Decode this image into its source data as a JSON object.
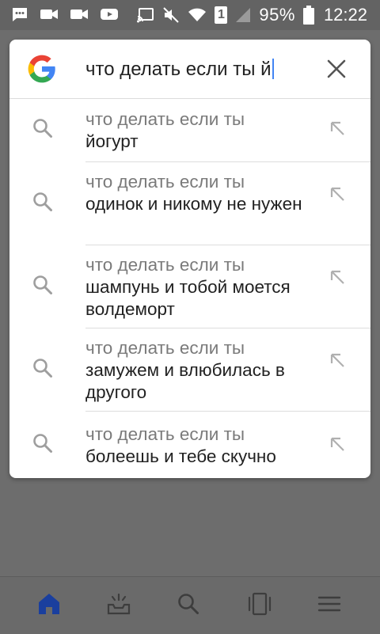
{
  "status_bar": {
    "battery_percent": "95%",
    "time": "12:22",
    "sim_slot": "1",
    "icons": [
      "message-icon",
      "video-icon",
      "video-icon",
      "youtube-icon",
      "cast-icon",
      "mute-icon",
      "wifi-icon",
      "sim-icon",
      "signal-icon",
      "battery-icon"
    ]
  },
  "search": {
    "logo": "google-g-icon",
    "query": "что делать если ты й",
    "clear_icon": "close-icon"
  },
  "suggestions": [
    {
      "prefix": "что делать если ты",
      "completion": "йогурт"
    },
    {
      "prefix": "что делать если ты",
      "completion": "одинок и никому не нужен"
    },
    {
      "prefix": "что делать если ты",
      "completion": "шампунь и тобой моется волдеморт"
    },
    {
      "prefix": "что делать если ты",
      "completion": "замужем и влюбилась в другого"
    },
    {
      "prefix": "что делать если ты",
      "completion": "болеешь и тебе скучно"
    }
  ],
  "bottom_nav": {
    "items": [
      "home-icon",
      "inbox-icon",
      "search-icon",
      "tabs-icon",
      "menu-icon"
    ],
    "active": "home-icon",
    "active_color": "#1a3f9e"
  }
}
